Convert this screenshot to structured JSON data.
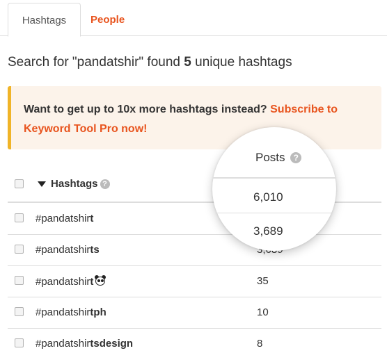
{
  "tabs": [
    {
      "label": "Hashtags",
      "active": true
    },
    {
      "label": "People",
      "active": false
    }
  ],
  "summary": {
    "prefix": "Search for \"pandatshir\" found ",
    "count": "5",
    "suffix": " unique hashtags"
  },
  "promo": {
    "text": "Want to get up to 10x more hashtags instead? ",
    "link": "Subscribe to Keyword Tool Pro now!"
  },
  "table": {
    "header_hashtags": "Hashtags",
    "header_posts": "Posts",
    "rows": [
      {
        "prefix": "#pandatshir",
        "bold": "t",
        "posts": "6,010"
      },
      {
        "prefix": "#pandatshir",
        "bold": "ts",
        "posts": "3,689"
      },
      {
        "prefix": "#pandatshir",
        "bold": "t",
        "emoji": "panda-face-icon",
        "posts": "35"
      },
      {
        "prefix": "#pandatshir",
        "bold": "tph",
        "posts": "10"
      },
      {
        "prefix": "#pandatshir",
        "bold": "tsdesign",
        "posts": "8"
      }
    ]
  },
  "colors": {
    "accent": "#e8541e",
    "promo_border": "#f0b428",
    "promo_bg": "#fcf3ea"
  }
}
